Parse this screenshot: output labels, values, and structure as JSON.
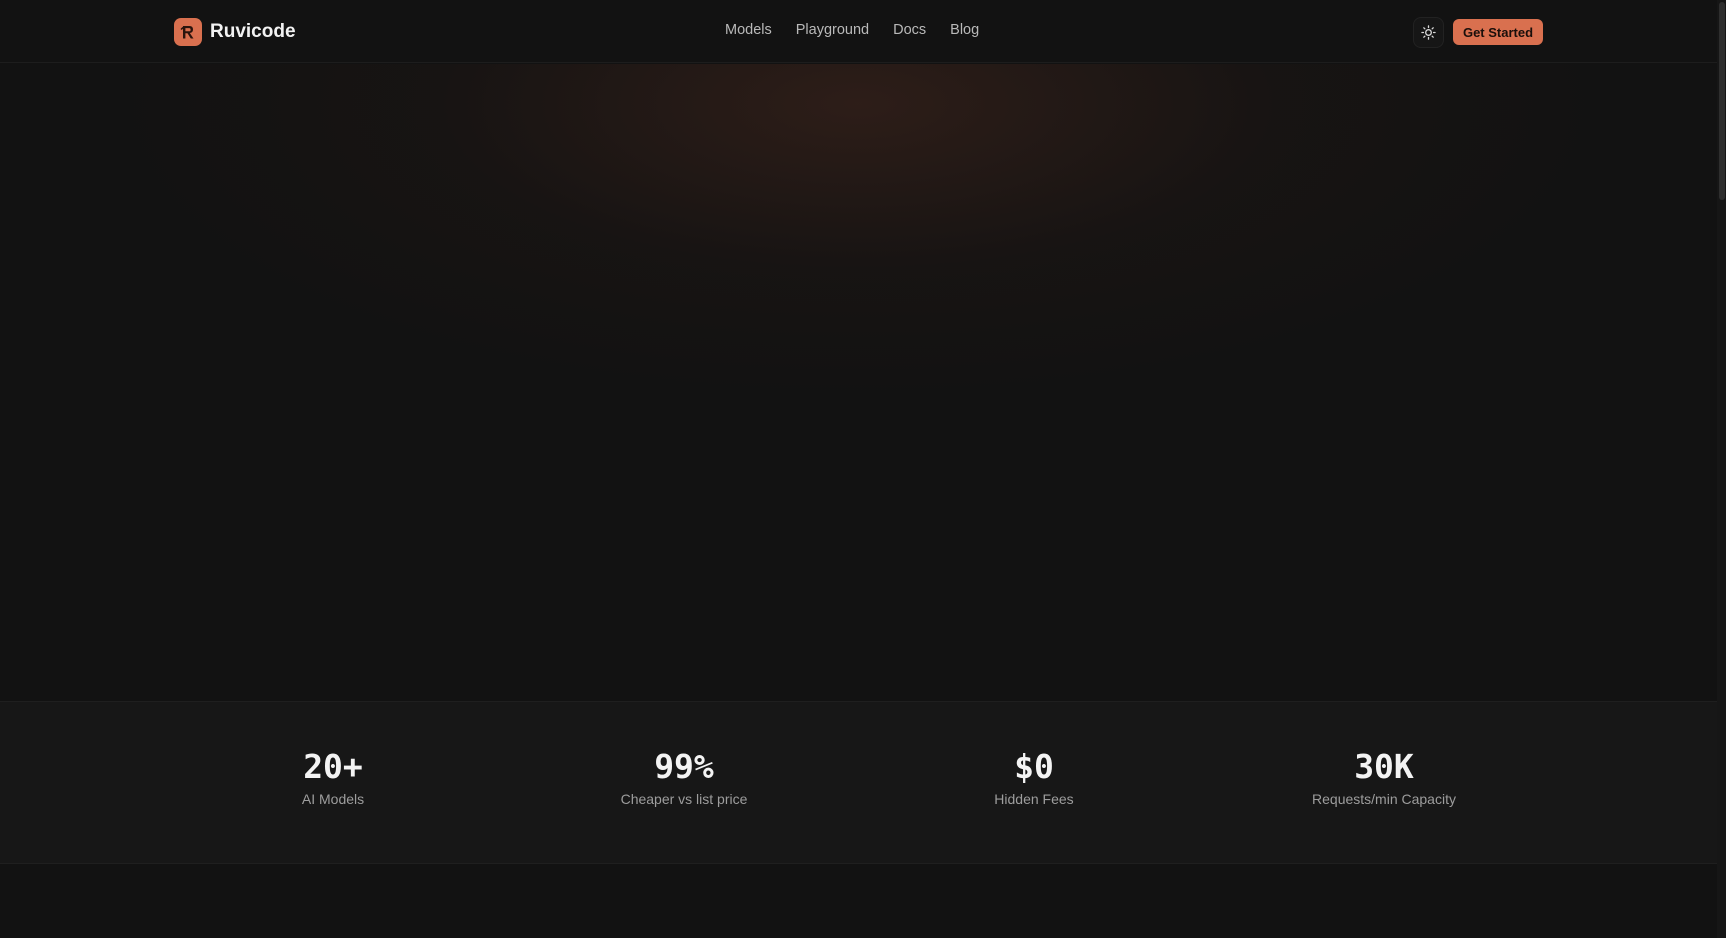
{
  "brand": {
    "name": "Ruvicode",
    "logo_icon": "ruvicode-logo-icon",
    "logo_letter": "R",
    "accent_color": "#d9704f"
  },
  "nav": {
    "links": [
      "Models",
      "Playground",
      "Docs",
      "Blog"
    ]
  },
  "header": {
    "theme_toggle_icon": "sun-icon",
    "cta_label": "Get Started"
  },
  "stats": [
    {
      "value": "20+",
      "label": "AI Models"
    },
    {
      "value": "99%",
      "label": "Cheaper vs list price"
    },
    {
      "value": "$0",
      "label": "Hidden Fees"
    },
    {
      "value": "30K",
      "label": "Requests/min Capacity"
    }
  ],
  "colors": {
    "background": "#121212",
    "stats_band": "#171717",
    "accent": "#d9704f"
  }
}
